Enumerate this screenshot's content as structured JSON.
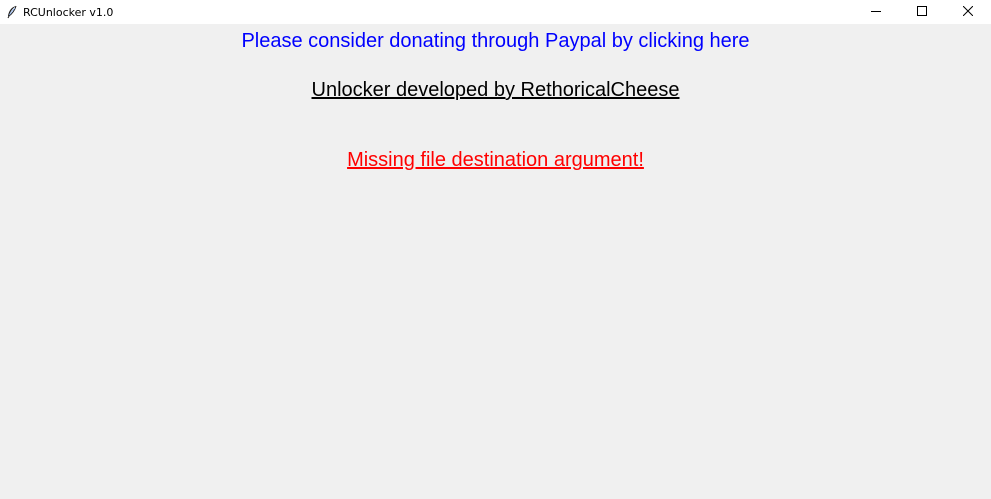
{
  "window": {
    "title": "RCUnlocker v1.0",
    "icon": "feather-icon",
    "controls": [
      "minimize-icon",
      "maximize-icon",
      "close-icon"
    ]
  },
  "content": {
    "donate_text": "Please consider donating through Paypal by clicking here",
    "credit_text": "Unlocker developed by RethoricalCheese",
    "error_text": "Missing file destination argument!"
  },
  "colors": {
    "background": "#f0f0f0",
    "titlebar": "#ffffff",
    "donate": "#0000ff",
    "credit": "#000000",
    "error": "#ff0000"
  }
}
